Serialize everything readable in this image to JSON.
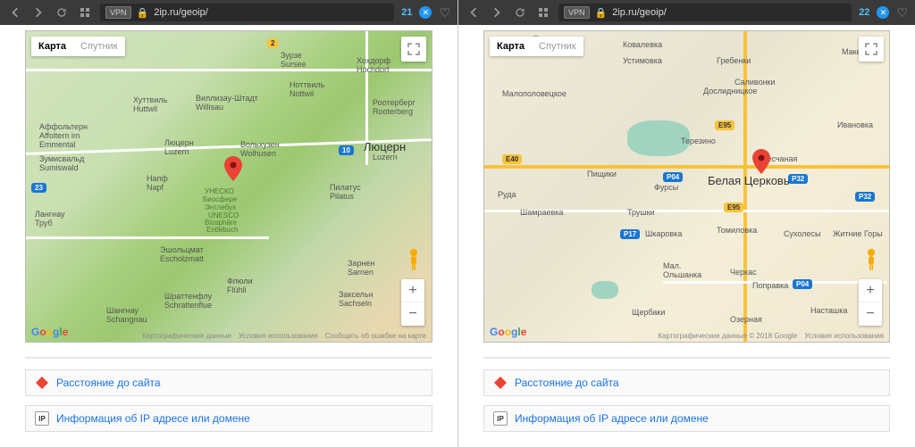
{
  "left": {
    "url": "2ip.ru/geoip/",
    "vpn": "VPN",
    "count": "21",
    "map": {
      "tab_map": "Карта",
      "tab_sat": "Спутник",
      "big_city": "Люцерн",
      "big_city_sub": "Luzern",
      "unesco1": "УНЕСКО",
      "unesco2": "Биосфере",
      "unesco3": "Энтлебух",
      "unesco4": "UNESCO",
      "unesco5": "Biosphäre",
      "unesco6": "Entlebuch",
      "places": {
        "hochdorf": "Хохдорф\nHochdorf",
        "sursee": "Зурзе\nSursee",
        "nottwil": "Ноттвиль\nNottwil",
        "rootberg": "Роотерберг\nRooterberg",
        "willisau": "Виллизау-Штадт\nWillisau",
        "huttwil": "Хуттвиль\nHuttwil",
        "affoltern": "Аффольтерн\nAffoltern im\nEmmental",
        "sumiswald": "Зумисвальд\nSumiswald",
        "lucern": "Люцерн\nLuzern",
        "napf": "Напф\nNapf",
        "wolhusen": "Вольхузен\nWolhusen",
        "pilatus": "Пилатус\nPilatus",
        "langnau": "Лангнау\nТруб",
        "escholzmatt": "Эшольцмат\nEscholzmatt",
        "fluhli": "Флюли\nFlühli",
        "sarnen": "Зарнен\nSarnen",
        "schangnau": "Шангнау\nSchangnau",
        "schrattenflu": "Шраттенфлу\nSchrattenflue",
        "sachseln": "Заксельн\nSachseln"
      },
      "roads": {
        "r2": "2",
        "r10": "10",
        "r23": "23"
      },
      "footer_data": "Картографические данные",
      "footer_terms": "Условия использования",
      "footer_report": "Сообщить об ошибке на карте"
    },
    "link1": "Расстояние до сайта",
    "link2": "Информация об IP адресе или домене",
    "ip_badge": "IP"
  },
  "right": {
    "url": "2ip.ru/geoip/",
    "vpn": "VPN",
    "count": "22",
    "map": {
      "tab_map": "Карта",
      "tab_sat": "Спутник",
      "big_city": "Белая Церковь",
      "places": {
        "trilesy": "Трилесы",
        "kovalevka": "Ковалевка",
        "ustimovka": "Устимовка",
        "grebenki": "Гребенки",
        "makeevka": "Макеевк",
        "salivonki": "Саливонки",
        "malopol": "Малополовецкое",
        "doslid": "Дослидницкое",
        "terezino": "Терезино",
        "ivanovka": "Ивановка",
        "pishchiki": "Пищики",
        "fursy": "Фурсы",
        "peschanaya": "Песчаная",
        "ruda": "Руда",
        "shamraevka": "Шамраевка",
        "trushki": "Трушки",
        "shkarovka": "Шкаровка",
        "tomilovka": "Томиловка",
        "suhol": "Сухолесы",
        "zhitnie": "Житние Горы",
        "olshanka": "Мал.\nОльшанка",
        "cherkas": "Черкас",
        "popravka": "Поправка",
        "shcherbaki": "Щербаки",
        "ozernaya": "Озерная",
        "nastashka": "Насташка"
      },
      "roads": {
        "e40": "E40",
        "e95": "E95",
        "p04": "P04",
        "p17": "P17",
        "p32": "P32"
      },
      "footer_data": "Картографические данные © 2018 Google",
      "footer_terms": "Условия использования"
    },
    "link1": "Расстояние до сайта",
    "link2": "Информация об IP адресе или домене",
    "ip_badge": "IP"
  }
}
